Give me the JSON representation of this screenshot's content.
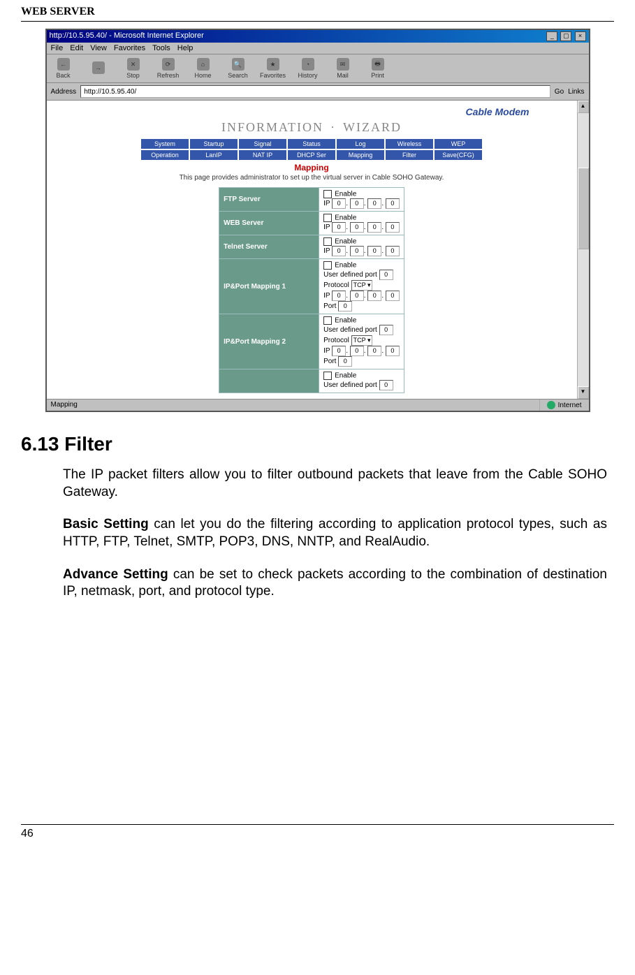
{
  "doc": {
    "header": "WEB SERVER",
    "section_heading": "6.13 Filter",
    "p1": "The IP packet filters allow you to filter outbound packets that leave from the Cable SOHO Gateway.",
    "p2_lead": "Basic Setting",
    "p2_rest": " can let you do the filtering according to application protocol types, such as HTTP, FTP, Telnet, SMTP, POP3, DNS, NNTP, and RealAudio.",
    "p3_lead": "Advance Setting",
    "p3_rest": " can be set to check packets according to the combination of destination IP, netmask, port, and protocol type.",
    "page_number": "46"
  },
  "ie": {
    "title": "http://10.5.95.40/ - Microsoft Internet Explorer",
    "menu": {
      "file": "File",
      "edit": "Edit",
      "view": "View",
      "favorites": "Favorites",
      "tools": "Tools",
      "help": "Help"
    },
    "toolbar": {
      "back": "Back",
      "forward": "",
      "stop": "Stop",
      "refresh": "Refresh",
      "home": "Home",
      "search": "Search",
      "favorites": "Favorites",
      "history": "History",
      "mail": "Mail",
      "print": "Print"
    },
    "address_label": "Address",
    "address_value": "http://10.5.95.40/",
    "go": "Go",
    "links": "Links",
    "status_left": "Mapping",
    "status_right": "Internet"
  },
  "content": {
    "brand": "Cable Modem",
    "info": "INFORMATION",
    "wizard": "WIZARD",
    "tabs1": {
      "a": "System",
      "b": "Startup",
      "c": "Signal",
      "d": "Status",
      "e": "Log",
      "f": "Wireless",
      "g": "WEP"
    },
    "tabs2": {
      "a": "Operation",
      "b": "LanIP",
      "c": "NAT IP",
      "d": "DHCP Ser",
      "e": "Mapping",
      "f": "Filter",
      "g": "Save(CFG)"
    },
    "map_title": "Mapping",
    "map_desc": "This page provides administrator to set up the virtual server in Cable SOHO Gateway.",
    "row_ftp": "FTP Server",
    "row_web": "WEB Server",
    "row_telnet": "Telnet Server",
    "row_ipm1": "IP&Port Mapping 1",
    "row_ipm2": "IP&Port Mapping 2",
    "enable": "Enable",
    "ip_label": "IP",
    "udp_label": "User defined port",
    "proto_label": "Protocol",
    "proto_val": "TCP",
    "port_label": "Port",
    "zero": "0"
  }
}
